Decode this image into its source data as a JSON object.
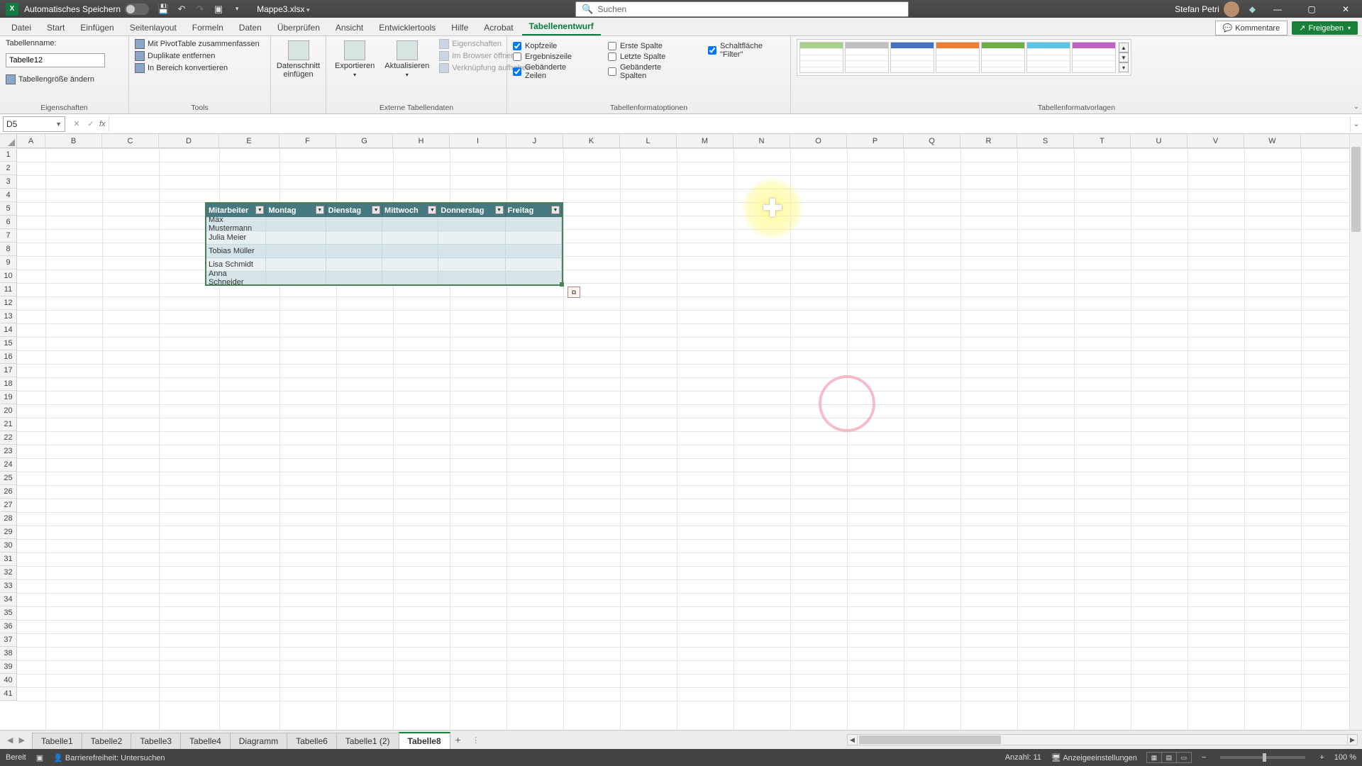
{
  "title_bar": {
    "autosave_label": "Automatisches Speichern",
    "filename": "Mappe3.xlsx",
    "search_placeholder": "Suchen",
    "user_name": "Stefan Petri"
  },
  "tabs": {
    "items": [
      "Datei",
      "Start",
      "Einfügen",
      "Seitenlayout",
      "Formeln",
      "Daten",
      "Überprüfen",
      "Ansicht",
      "Entwicklertools",
      "Hilfe",
      "Acrobat",
      "Tabellenentwurf"
    ],
    "active": "Tabellenentwurf",
    "comments": "Kommentare",
    "share": "Freigeben"
  },
  "ribbon": {
    "table_name_label": "Tabellenname:",
    "table_name_value": "Tabelle12",
    "resize": "Tabellengröße ändern",
    "group_props": "Eigenschaften",
    "pivot": "Mit PivotTable zusammenfassen",
    "dupes": "Duplikate entfernen",
    "convert": "In Bereich konvertieren",
    "group_tools": "Tools",
    "slicer": "Datenschnitt einfügen",
    "export": "Exportieren",
    "refresh": "Aktualisieren",
    "props": "Eigenschaften",
    "browser": "Im Browser öffnen",
    "unlink": "Verknüpfung aufheben",
    "group_ext": "Externe Tabellendaten",
    "opt_header": "Kopfzeile",
    "opt_total": "Ergebniszeile",
    "opt_banded_rows": "Gebänderte Zeilen",
    "opt_first_col": "Erste Spalte",
    "opt_last_col": "Letzte Spalte",
    "opt_banded_cols": "Gebänderte Spalten",
    "opt_filter": "Schaltfläche \"Filter\"",
    "group_opts": "Tabellenformatoptionen",
    "group_styles": "Tabellenformatvorlagen"
  },
  "formula": {
    "cell_ref": "D5",
    "value": ""
  },
  "columns": [
    "A",
    "B",
    "C",
    "D",
    "E",
    "F",
    "G",
    "H",
    "I",
    "J",
    "K",
    "L",
    "M",
    "N",
    "O",
    "P",
    "Q",
    "R",
    "S",
    "T",
    "U",
    "V",
    "W"
  ],
  "table": {
    "headers": [
      "Mitarbeiter",
      "Montag",
      "Dienstag",
      "Mittwoch",
      "Donnerstag",
      "Freitag"
    ],
    "rows": [
      [
        "Max Mustermann",
        "",
        "",
        "",
        "",
        ""
      ],
      [
        "Julia Meier",
        "",
        "",
        "",
        "",
        ""
      ],
      [
        "Tobias Müller",
        "",
        "",
        "",
        "",
        ""
      ],
      [
        "Lisa Schmidt",
        "",
        "",
        "",
        "",
        ""
      ],
      [
        "Anna Schneider",
        "",
        "",
        "",
        "",
        ""
      ]
    ]
  },
  "sheets": {
    "items": [
      "Tabelle1",
      "Tabelle2",
      "Tabelle3",
      "Tabelle4",
      "Diagramm",
      "Tabelle6",
      "Tabelle1 (2)",
      "Tabelle8"
    ],
    "active": "Tabelle8"
  },
  "status": {
    "ready": "Bereit",
    "access": "Barrierefreiheit: Untersuchen",
    "count_label": "Anzahl:",
    "count_value": "11",
    "display": "Anzeigeeinstellungen",
    "zoom": "100 %"
  }
}
